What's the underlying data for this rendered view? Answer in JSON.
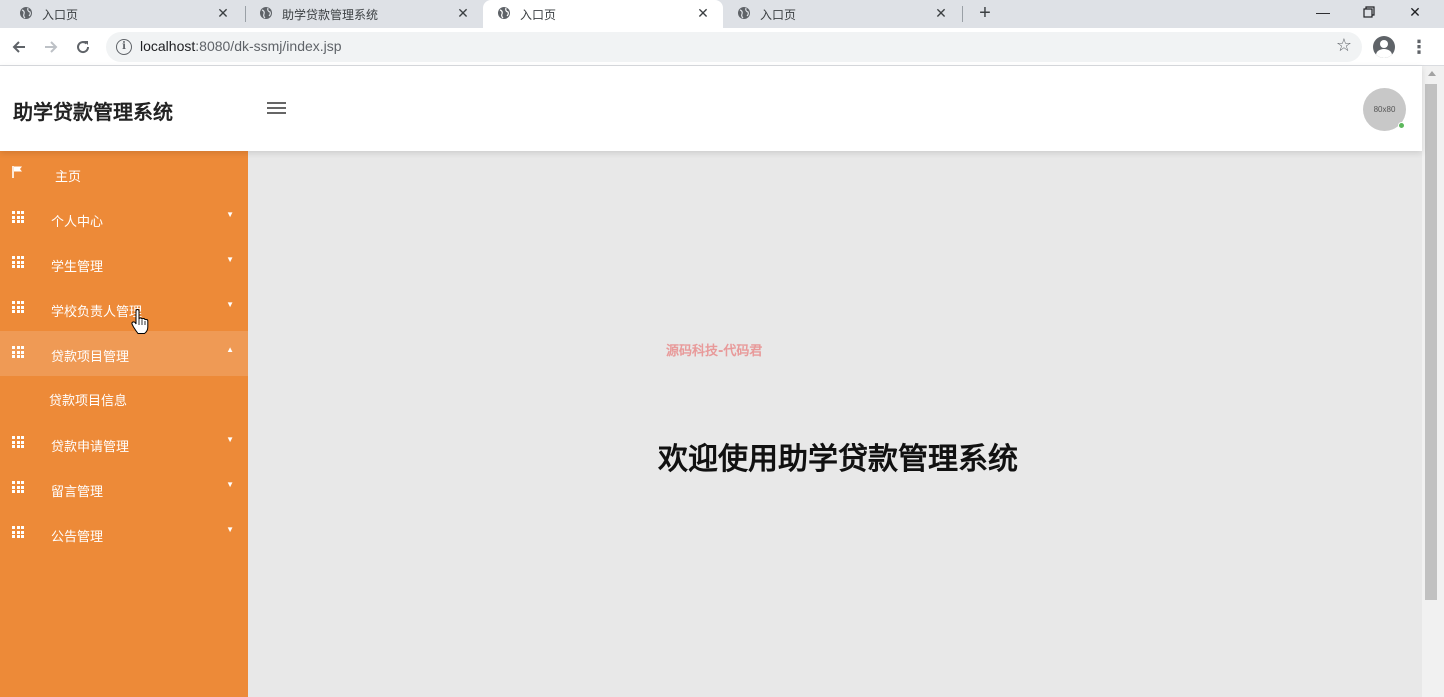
{
  "browser": {
    "tabs": [
      {
        "title": "入口页",
        "active": false
      },
      {
        "title": "助学贷款管理系统",
        "active": false
      },
      {
        "title": "入口页",
        "active": true
      },
      {
        "title": "入口页",
        "active": false
      }
    ],
    "url_host": "localhost",
    "url_path": ":8080/dk-ssmj/index.jsp",
    "icons": {
      "back": "back-arrow-icon",
      "forward": "forward-arrow-icon",
      "reload": "reload-icon",
      "info": "site-info-icon",
      "bookmark": "star-icon",
      "profile": "profile-icon",
      "menu": "kebab-menu-icon",
      "new_tab": "plus-icon",
      "minimize": "minimize-icon",
      "restore": "restore-icon",
      "close": "close-icon"
    }
  },
  "app": {
    "title": "助学贷款管理系统",
    "avatar_text": "80x80",
    "accent_color": "#ed8a38",
    "sidebar": {
      "items": [
        {
          "label": "主页",
          "icon": "flag-icon",
          "has_caret": false
        },
        {
          "label": "个人中心",
          "icon": "grid-icon",
          "has_caret": true,
          "expanded": false
        },
        {
          "label": "学生管理",
          "icon": "grid-icon",
          "has_caret": true,
          "expanded": false
        },
        {
          "label": "学校负责人管理",
          "icon": "grid-icon",
          "has_caret": true,
          "expanded": false
        },
        {
          "label": "贷款项目管理",
          "icon": "grid-icon",
          "has_caret": true,
          "expanded": true,
          "children": [
            {
              "label": "贷款项目信息"
            }
          ]
        },
        {
          "label": "贷款申请管理",
          "icon": "grid-icon",
          "has_caret": true,
          "expanded": false
        },
        {
          "label": "留言管理",
          "icon": "grid-icon",
          "has_caret": true,
          "expanded": false
        },
        {
          "label": "公告管理",
          "icon": "grid-icon",
          "has_caret": true,
          "expanded": false
        }
      ]
    },
    "content": {
      "watermark": "源码科技-代码君",
      "welcome": "欢迎使用助学贷款管理系统"
    }
  }
}
